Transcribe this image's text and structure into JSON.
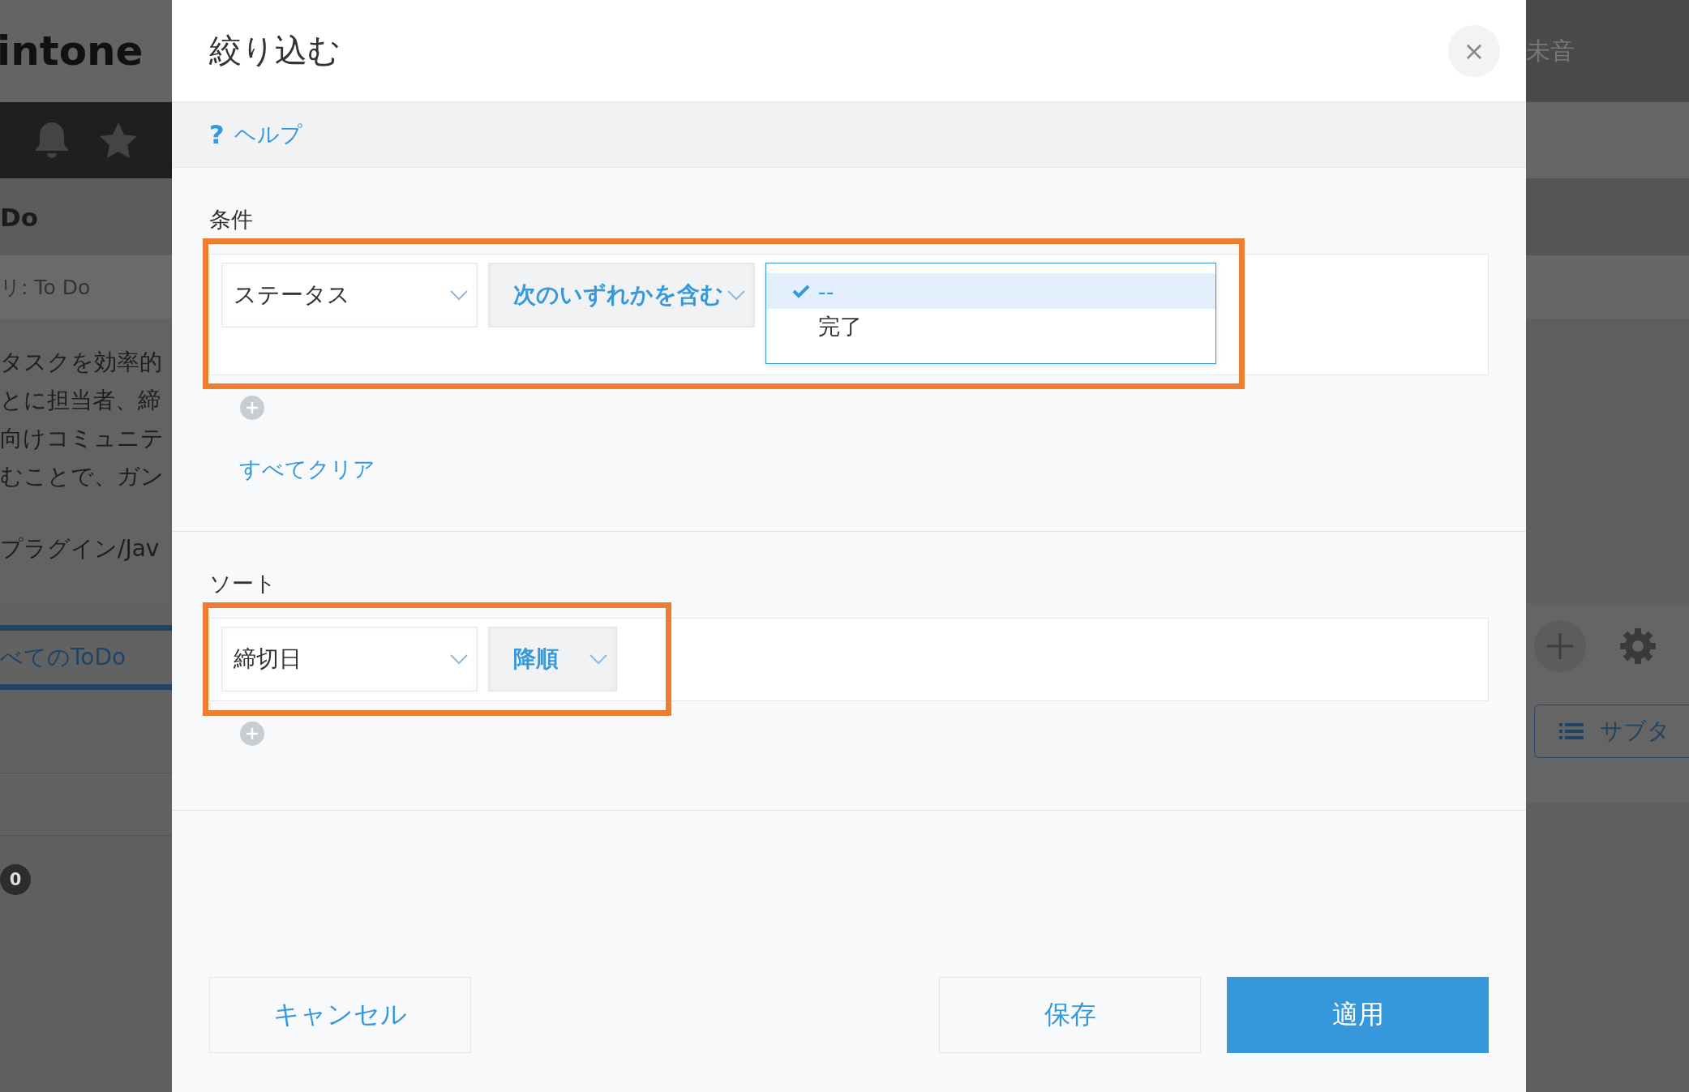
{
  "background": {
    "app_name": "intone",
    "app_title": "Do",
    "breadcrumb": "リ: To Do",
    "description": [
      "タスクを効率的",
      "とに担当者、締",
      "向けコミュニテ",
      "むことで、ガン"
    ],
    "note": "プラグイン/Jav",
    "view_tab": "べてのToDo",
    "count": "0",
    "user_name": "未音",
    "subtable_button": "サブタ"
  },
  "dialog": {
    "title": "絞り込む",
    "close": "×",
    "help_icon": "?",
    "help_link": "ヘルプ",
    "filter": {
      "label": "条件",
      "field": "ステータス",
      "operator": "次のいずれかを含む",
      "options": [
        {
          "label": "--",
          "selected": true
        },
        {
          "label": "完了",
          "selected": false
        }
      ],
      "clear_all": "すべてクリア"
    },
    "sort": {
      "label": "ソート",
      "field": "締切日",
      "order": "降順"
    },
    "buttons": [
      {
        "label": "キャンセル",
        "kind": "cancel"
      },
      {
        "label": "保存",
        "kind": "save"
      },
      {
        "label": "適用",
        "kind": "apply"
      }
    ]
  }
}
